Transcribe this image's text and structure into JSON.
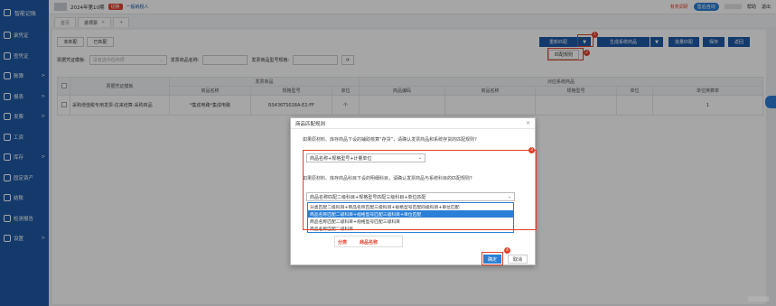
{
  "sidebar": {
    "brand": "智能记账",
    "items": [
      {
        "label": "录凭证",
        "icon": "edit-icon",
        "arrow": ""
      },
      {
        "label": "查凭证",
        "icon": "search-icon",
        "arrow": ""
      },
      {
        "label": "账簿",
        "icon": "book-icon",
        "arrow": ">"
      },
      {
        "label": "报表",
        "icon": "chart-icon",
        "arrow": ">"
      },
      {
        "label": "发票",
        "icon": "invoice-icon",
        "arrow": ">"
      },
      {
        "label": "工资",
        "icon": "wallet-icon",
        "arrow": ""
      },
      {
        "label": "库存",
        "icon": "box-icon",
        "arrow": ">"
      },
      {
        "label": "固定资产",
        "icon": "asset-icon",
        "arrow": ""
      },
      {
        "label": "结账",
        "icon": "check-icon",
        "arrow": ""
      },
      {
        "label": "检测报告",
        "icon": "report-icon",
        "arrow": ""
      },
      {
        "label": "设置",
        "icon": "gear-icon",
        "arrow": ">"
      }
    ]
  },
  "topbar": {
    "period": "2024年第10期",
    "period_tag": "切换",
    "taxpayer": "一般纳税人",
    "right": [
      "有奖调研",
      "售后咨询",
      "帮助",
      "退出"
    ]
  },
  "tabs": [
    {
      "label": "首页",
      "active": false,
      "close": ""
    },
    {
      "label": "进项票",
      "active": true,
      "close": "×"
    },
    {
      "label": "+",
      "active": false,
      "close": ""
    }
  ],
  "main": {
    "left_buttons": [
      "未匹配",
      "已匹配"
    ],
    "right_buttons": {
      "rematch": "重新匹配",
      "rematch_dd": "▼",
      "generate": "生成系统商品",
      "generate_dd": "▼",
      "batch": "批量匹配",
      "save": "保存",
      "back": "返回",
      "match_rule": "匹配规则"
    },
    "filters": {
      "template_label": "票据凭证模板:",
      "template_placeholder": "没有选中任何项",
      "name_label": "发票商品名称:",
      "spec_label": "发票商品型号规格:",
      "refresh": "⟳"
    },
    "table": {
      "group_headers": [
        "票据凭证模板",
        "发票商品",
        "对应系统商品"
      ],
      "columns": [
        "商品名称",
        "规格型号",
        "单位",
        "商品编码",
        "商品名称",
        "规格型号",
        "单位",
        "单位换算率"
      ],
      "row": [
        "采购增值税专用发票-往来结算-采购商品",
        "*集成电路*集成电路",
        "RS436TS028A-E2-FF",
        "个",
        "",
        "",
        "",
        "",
        "1"
      ]
    }
  },
  "modal": {
    "title": "商品匹配规则",
    "close": "×",
    "hint1": "如果原材料、库存商品下设的辅助核算“存货”，请确认发票商品和系统存货的匹配规则?",
    "select1": "商品名称+规格型号+计量单位",
    "hint2": "如果原材料、库存商品科目下设的明细科目，请确认发票商品与系统科目的匹配规则?",
    "select2": "商品名称匹配二级科目+规格型号匹配三级科目+单位匹配",
    "options": [
      "分类匹配二级科目+商品名称匹配三级科目+规格型号匹配四级科目+单位匹配",
      "商品名称匹配二级科目+规格型号匹配三级科目+单位匹配",
      "商品名称匹配二级科目+规格型号匹配三级科目",
      "商品名称匹配二级科目"
    ],
    "selected_index": 1,
    "annotation": [
      "分类",
      "商品名称"
    ],
    "confirm": "确定",
    "cancel": "取消"
  },
  "badges": [
    "1",
    "2",
    "3",
    "4"
  ],
  "colors": {
    "sidebar": "#1f5aa6",
    "accent": "#2a7fd6",
    "annotation": "#e0412b"
  }
}
